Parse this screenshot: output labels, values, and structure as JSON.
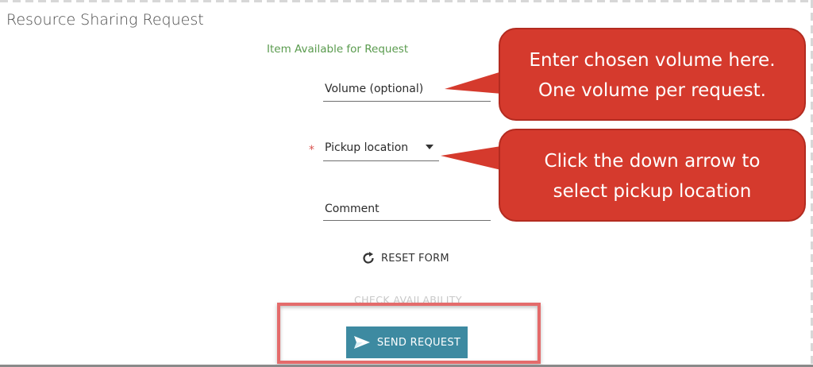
{
  "page": {
    "title": "Resource Sharing Request",
    "availability_text": "Item Available for Request"
  },
  "form": {
    "volume_label": "Volume (optional)",
    "pickup_label": "Pickup location",
    "pickup_required_mark": "*",
    "comment_label": "Comment",
    "reset_label": "RESET FORM",
    "check_availability_label": "CHECK AVAILABILITY",
    "send_label": "SEND REQUEST"
  },
  "annotations": {
    "volume_callout_line1": "Enter chosen volume here.",
    "volume_callout_line2": "One volume per request.",
    "pickup_callout_line1": "Click the down arrow to",
    "pickup_callout_line2": "select pickup location"
  },
  "icons": {
    "reset": "refresh-icon",
    "send": "paper-plane-icon",
    "dropdown": "caret-down-icon"
  },
  "colors": {
    "availability_green": "#5a9b4e",
    "send_button": "#3d8aa1",
    "callout_red": "#d53a2d",
    "highlight_border": "#e46b6b",
    "required_star": "#d9534f"
  }
}
